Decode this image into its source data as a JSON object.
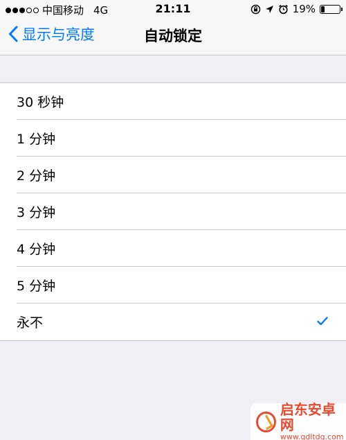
{
  "status_bar": {
    "carrier": "中国移动",
    "network": "4G",
    "time": "21:11",
    "battery": "19%",
    "battery_level": 0.19,
    "signal_bars_filled": 3,
    "signal_bars_total": 5,
    "icons": [
      "lock-rotation-icon",
      "location-arrow-icon",
      "alarm-icon",
      "battery-icon"
    ]
  },
  "nav": {
    "back_label": "显示与亮度",
    "title": "自动锁定"
  },
  "options": [
    {
      "label": "30 秒钟",
      "selected": false
    },
    {
      "label": "1 分钟",
      "selected": false
    },
    {
      "label": "2 分钟",
      "selected": false
    },
    {
      "label": "3 分钟",
      "selected": false
    },
    {
      "label": "4 分钟",
      "selected": false
    },
    {
      "label": "5 分钟",
      "selected": false
    },
    {
      "label": "永不",
      "selected": true
    }
  ],
  "watermark": {
    "name": "启东安卓网",
    "url": "www.qdltdg.com"
  },
  "colors": {
    "accent": "#007aff",
    "background": "#efeff4",
    "separator": "#c8c7cc",
    "watermark": "#e8492f"
  }
}
